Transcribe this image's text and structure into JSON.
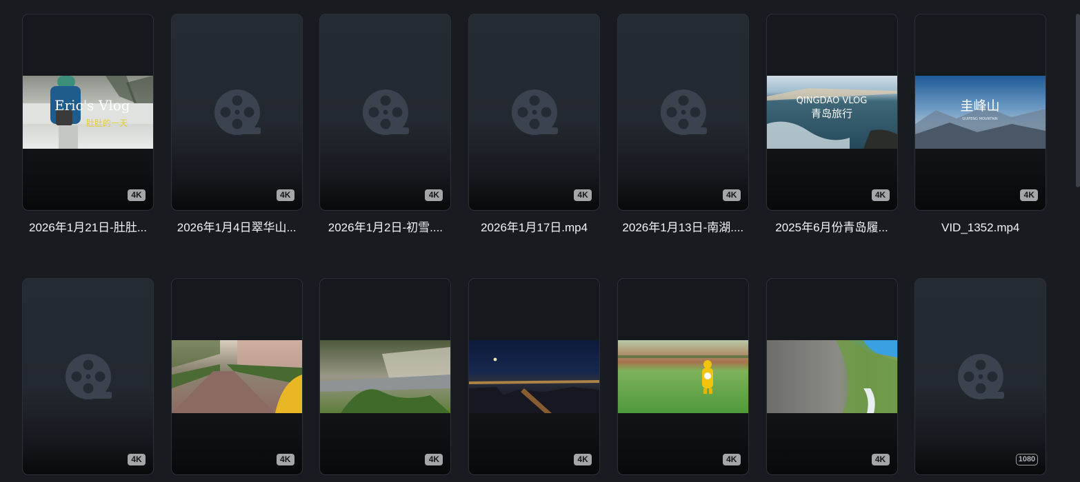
{
  "gallery": {
    "items": [
      {
        "name": "2026年1月21日-肚肚...",
        "badge": "4K",
        "type": "vlog-snow",
        "overlay_title": "Eric's Vlog",
        "overlay_sub": "肚肚的一天"
      },
      {
        "name": "2026年1月4日翠华山...",
        "badge": "4K",
        "type": "placeholder"
      },
      {
        "name": "2026年1月2日-初雪....",
        "badge": "4K",
        "type": "placeholder"
      },
      {
        "name": "2026年1月17日.mp4",
        "badge": "4K",
        "type": "placeholder"
      },
      {
        "name": "2026年1月13日-南湖....",
        "badge": "4K",
        "type": "placeholder"
      },
      {
        "name": "2025年6月份青岛履...",
        "badge": "4K",
        "type": "sea",
        "overlay_title": "QINGDAO VLOG",
        "overlay_sub": "青岛旅行"
      },
      {
        "name": "VID_1352.mp4",
        "badge": "4K",
        "type": "mountain",
        "overlay_title": "圭峰山",
        "overlay_sub": "GUIFENG MOUNTAIN"
      },
      {
        "name": "",
        "badge": "4K",
        "type": "placeholder"
      },
      {
        "name": "",
        "badge": "4K",
        "type": "street"
      },
      {
        "name": "",
        "badge": "4K",
        "type": "hillside"
      },
      {
        "name": "",
        "badge": "4K",
        "type": "night"
      },
      {
        "name": "",
        "badge": "4K",
        "type": "field"
      },
      {
        "name": "",
        "badge": "4K",
        "type": "cliff"
      },
      {
        "name": "",
        "badge": "1080",
        "badge_style": "outline",
        "type": "placeholder"
      }
    ]
  },
  "colors": {
    "background": "#181b20",
    "card_border": "#2c3139",
    "reel_icon": "#3b4350",
    "badge_bg": "#a4a6a9",
    "filename_text": "#f2f3f5"
  },
  "icons": {
    "placeholder": "film-reel-icon",
    "scrollbar": "scrollbar-thumb"
  }
}
